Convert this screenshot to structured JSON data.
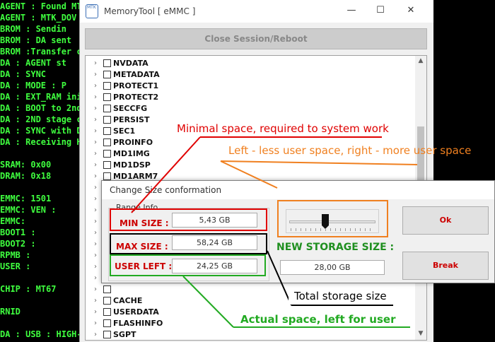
{
  "console": {
    "lines": [
      "AGENT : Found MT",
      "AGENT : MTK_DOV",
      "   BROM : Sendin",
      "BROM : DA sent",
      "BROM :Transfer c",
      "     DA : AGENT st",
      "DA : SYNC",
      "     DA : MODE : P",
      "DA : EXT_RAM ini",
      "DA : BOOT to 2nd",
      "DA : 2ND stage c",
      "DA : SYNC with D",
      "DA : Receiving H\\",
      "",
      "     SRAM: 0x00",
      "     DRAM: 0x18",
      "",
      "     EMMC: 1501",
      "     EMMC: VEN :",
      "     EMMC:",
      "          BOOT1  :",
      "          BOOT2  :",
      "          RPMB   :",
      "          USER   :",
      "",
      "     CHIP : MT67",
      "",
      "     RNID",
      "",
      "DA : USB : HIGH-S"
    ]
  },
  "window": {
    "logo_text": "MTK",
    "title": "MemoryTool [ eMMC ]",
    "minimize_glyph": "—",
    "maximize_glyph": "☐",
    "close_glyph": "✕",
    "close_session_label": "Close Session/Reboot"
  },
  "tree": {
    "arrow_glyph": "›",
    "items": [
      "NVDATA",
      "METADATA",
      "PROTECT1",
      "PROTECT2",
      "SECCFG",
      "PERSIST",
      "SEC1",
      "PROINFO",
      "MD1IMG",
      "MD1DSP",
      "MD1ARM7",
      "",
      "",
      "",
      "",
      "",
      "",
      "",
      "",
      "",
      "",
      "CACHE",
      "USERDATA",
      "FLASHINFO",
      "SGPT"
    ],
    "scroll_up_glyph": "▲",
    "scroll_down_glyph": "▼"
  },
  "dialog": {
    "title": "Change Size conformation",
    "group_label": "Range Info",
    "min_size_label": "MIN SIZE :",
    "min_size_value": "5,43 GB",
    "max_size_label": "MAX SIZE :",
    "max_size_value": "58,24 GB",
    "user_left_label": "USER LEFT :",
    "user_left_value": "24,25 GB",
    "slider_fraction": 0.41,
    "new_storage_label": "NEW STORAGE SIZE :",
    "new_storage_value": "28,00 GB",
    "ok_label": "Ok",
    "break_label": "Break"
  },
  "annotations": {
    "min_space": "Minimal space, required to system work",
    "slider_hint": "Left - less user space, right - more user space",
    "total_storage": "Total storage size",
    "actual_space": "Actual space, left for user"
  },
  "colors": {
    "console_text": "#3fff3f",
    "annotation_red": "#e00000",
    "annotation_orange": "#f08020",
    "annotation_black": "#000000",
    "annotation_green": "#22aa22",
    "dialog_red_text": "#cc0000",
    "dialog_green_text": "#1f8f1f"
  }
}
